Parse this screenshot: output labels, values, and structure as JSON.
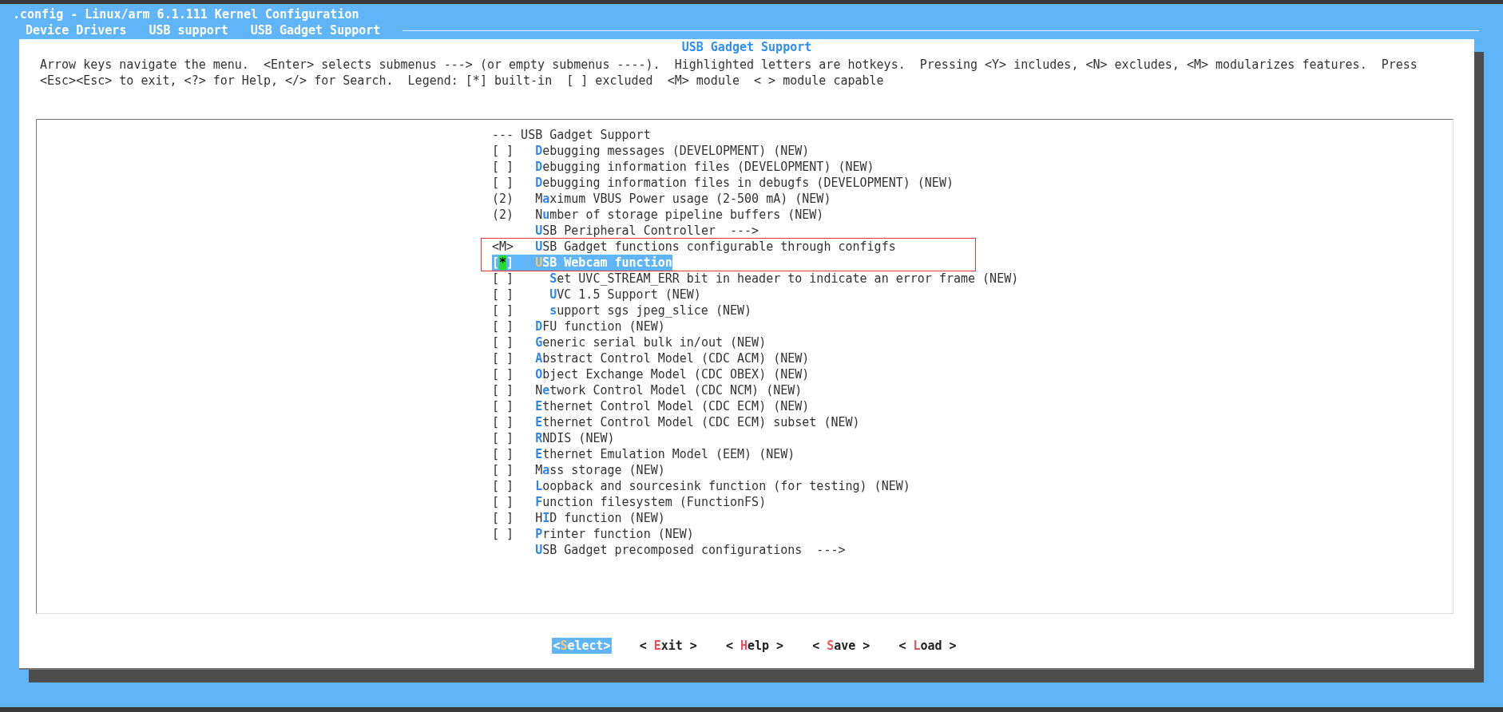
{
  "window": {
    "title": ".config - Linux/arm 6.1.111 Kernel Configuration"
  },
  "breadcrumb": [
    "Device Drivers",
    "USB support",
    "USB Gadget Support"
  ],
  "dialog": {
    "title": "USB Gadget Support",
    "help": [
      "Arrow keys navigate the menu.  <Enter> selects submenus ---> (or empty submenus ----).  Highlighted letters are hotkeys.  Pressing <Y> includes, <N> excludes, <M> modularizes features.  Press",
      "<Esc><Esc> to exit, <?> for Help, </> for Search.  Legend: [*] built-in  [ ] excluded  <M> module  < > module capable"
    ]
  },
  "menu": {
    "header": "--- USB Gadget Support",
    "items": [
      {
        "prefix": "[ ]",
        "label": "**D**ebugging messages (DEVELOPMENT) (NEW)",
        "selected": false,
        "boxed": false
      },
      {
        "prefix": "[ ]",
        "label": "**D**ebugging information files (DEVELOPMENT) (NEW)",
        "selected": false,
        "boxed": false
      },
      {
        "prefix": "[ ]",
        "label": "**D**ebugging information files in debugfs (DEVELOPMENT) (NEW)",
        "selected": false,
        "boxed": false
      },
      {
        "prefix": "(2)",
        "label": "M**a**ximum VBUS Power usage (2-500 mA) (NEW)",
        "selected": false,
        "boxed": false
      },
      {
        "prefix": "(2)",
        "label": "N**u**mber of storage pipeline buffers (NEW)",
        "selected": false,
        "boxed": false
      },
      {
        "label": "**U**SB Peripheral Controller  --->",
        "selected": false,
        "boxed": false
      },
      {
        "prefix": "<M>",
        "label": "**U**SB Gadget functions configurable through configfs",
        "selected": false,
        "boxed": true
      },
      {
        "prefix": "[*]",
        "label": "**U**SB Webcam function",
        "selected": true,
        "boxed": true,
        "children": [
          {
            "prefix": "[ ]",
            "label": "**S**et UVC_STREAM_ERR bit in header to indicate an error frame (NEW)",
            "selected": false,
            "boxed": false
          },
          {
            "prefix": "[ ]",
            "label": "**U**VC 1.5 Support (NEW)",
            "selected": false,
            "boxed": false
          },
          {
            "prefix": "[ ]",
            "label": "**s**upport sgs jpeg_slice (NEW)",
            "selected": false,
            "boxed": false
          }
        ]
      },
      {
        "prefix": "[ ]",
        "label": "**D**FU function (NEW)",
        "selected": false,
        "boxed": false
      },
      {
        "prefix": "[ ]",
        "label": "**G**eneric serial bulk in/out (NEW)",
        "selected": false,
        "boxed": false
      },
      {
        "prefix": "[ ]",
        "label": "**A**bstract Control Model (CDC ACM) (NEW)",
        "selected": false,
        "boxed": false
      },
      {
        "prefix": "[ ]",
        "label": "**O**bject Exchange Model (CDC OBEX) (NEW)",
        "selected": false,
        "boxed": false
      },
      {
        "prefix": "[ ]",
        "label": "N**e**twork Control Model (CDC NCM) (NEW)",
        "selected": false,
        "boxed": false
      },
      {
        "prefix": "[ ]",
        "label": "**E**thernet Control Model (CDC ECM) (NEW)",
        "selected": false,
        "boxed": false
      },
      {
        "prefix": "[ ]",
        "label": "**E**thernet Control Model (CDC ECM) subset (NEW)",
        "selected": false,
        "boxed": false
      },
      {
        "prefix": "[ ]",
        "label": "**R**NDIS (NEW)",
        "selected": false,
        "boxed": false
      },
      {
        "prefix": "[ ]",
        "label": "**E**thernet Emulation Model (EEM) (NEW)",
        "selected": false,
        "boxed": false
      },
      {
        "prefix": "[ ]",
        "label": "M**a**ss storage (NEW)",
        "selected": false,
        "boxed": false
      },
      {
        "prefix": "[ ]",
        "label": "**L**oopback and sourcesink function (for testing) (NEW)",
        "selected": false,
        "boxed": false
      },
      {
        "prefix": "[ ]",
        "label": "**F**unction filesystem (FunctionFS)",
        "selected": false,
        "boxed": false
      },
      {
        "prefix": "[ ]",
        "label": "H**I**D function (NEW)",
        "selected": false,
        "boxed": false
      },
      {
        "prefix": "[ ]",
        "label": "**P**rinter function (NEW)",
        "selected": false,
        "boxed": false
      },
      {
        "label": "**U**SB Gadget precomposed configurations  --->",
        "selected": false,
        "boxed": false
      }
    ]
  },
  "buttons": [
    {
      "label": "<**S**elect>",
      "selected": true
    },
    {
      "label": "< **E**xit >",
      "selected": false
    },
    {
      "label": "< **H**elp >",
      "selected": false
    },
    {
      "label": "< **S**ave >",
      "selected": false
    },
    {
      "label": "< **L**oad >",
      "selected": false
    }
  ]
}
